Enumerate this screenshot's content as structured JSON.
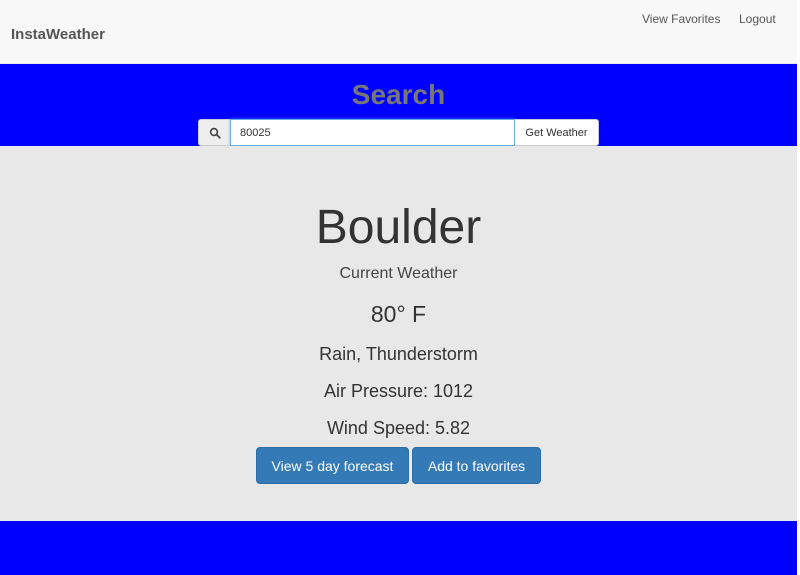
{
  "navbar": {
    "brand": "InstaWeather",
    "links": [
      "View Favorites",
      "Logout"
    ]
  },
  "search": {
    "title": "Search",
    "icon": "search-icon",
    "value": "80025",
    "button_label": "Get Weather"
  },
  "weather": {
    "city": "Boulder",
    "subtitle": "Current Weather",
    "temperature": "80° F",
    "condition": "Rain, Thunderstorm",
    "pressure": "Air Pressure: 1012",
    "wind": "Wind Speed: 5.82"
  },
  "actions": {
    "forecast_label": "View 5 day forecast",
    "favorites_label": "Add to favorites"
  },
  "colors": {
    "background": "#0000ff",
    "navbar": "#f8f8f8",
    "panel": "#e8e8e8",
    "primary_button": "#337ab7"
  }
}
